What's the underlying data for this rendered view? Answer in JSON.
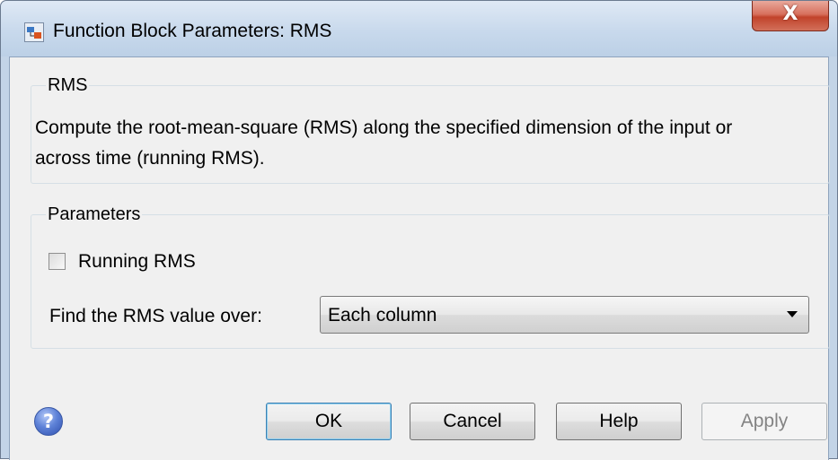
{
  "window": {
    "title": "Function Block Parameters: RMS",
    "close_glyph": "X",
    "app_icon": "simulink-block-icon"
  },
  "block_group": {
    "label": "RMS",
    "description": "Compute the root-mean-square (RMS) along the specified dimension of the input or across time (running RMS)."
  },
  "parameters_group": {
    "label": "Parameters",
    "running_rms": {
      "label": "Running RMS",
      "checked": false
    },
    "find_over": {
      "label": "Find the RMS value over:",
      "value": "Each column"
    }
  },
  "footer": {
    "help_icon_glyph": "?",
    "ok_label": "OK",
    "cancel_label": "Cancel",
    "help_label": "Help",
    "apply_label": "Apply"
  },
  "colors": {
    "close_button": "#c1432b",
    "default_button_border": "#3c7fb1",
    "help_icon": "#2e4fae"
  }
}
